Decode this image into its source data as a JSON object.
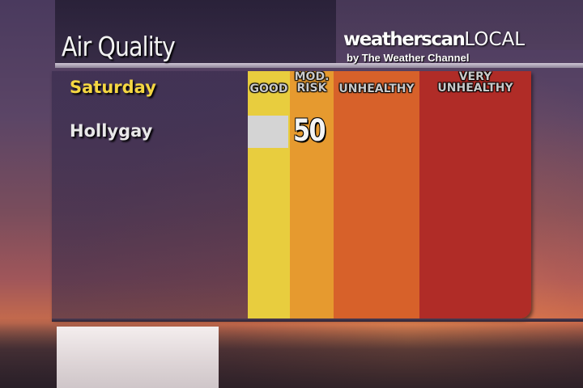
{
  "header": {
    "title": "Air Quality",
    "logo_main_strong": "weatherscan",
    "logo_main_light": "LOCAL",
    "logo_sub": "by The Weather Channel"
  },
  "forecast": {
    "day": "Saturday",
    "location": "Hollygay",
    "aqi_value": "50"
  },
  "scale": {
    "bands": [
      {
        "line1": "GOOD",
        "line2": "",
        "color": "#e8cd3e"
      },
      {
        "line1": "MOD.",
        "line2": "RISK",
        "color": "#e69a2f"
      },
      {
        "line1": "UNHEALTHY",
        "line2": "",
        "color": "#d7612a"
      },
      {
        "line1": "VERY",
        "line2": "UNHEALTHY",
        "color": "#b02c27"
      }
    ]
  },
  "colors": {
    "day_label": "#f5d742",
    "aqi_bar": "#d4d4d4"
  }
}
